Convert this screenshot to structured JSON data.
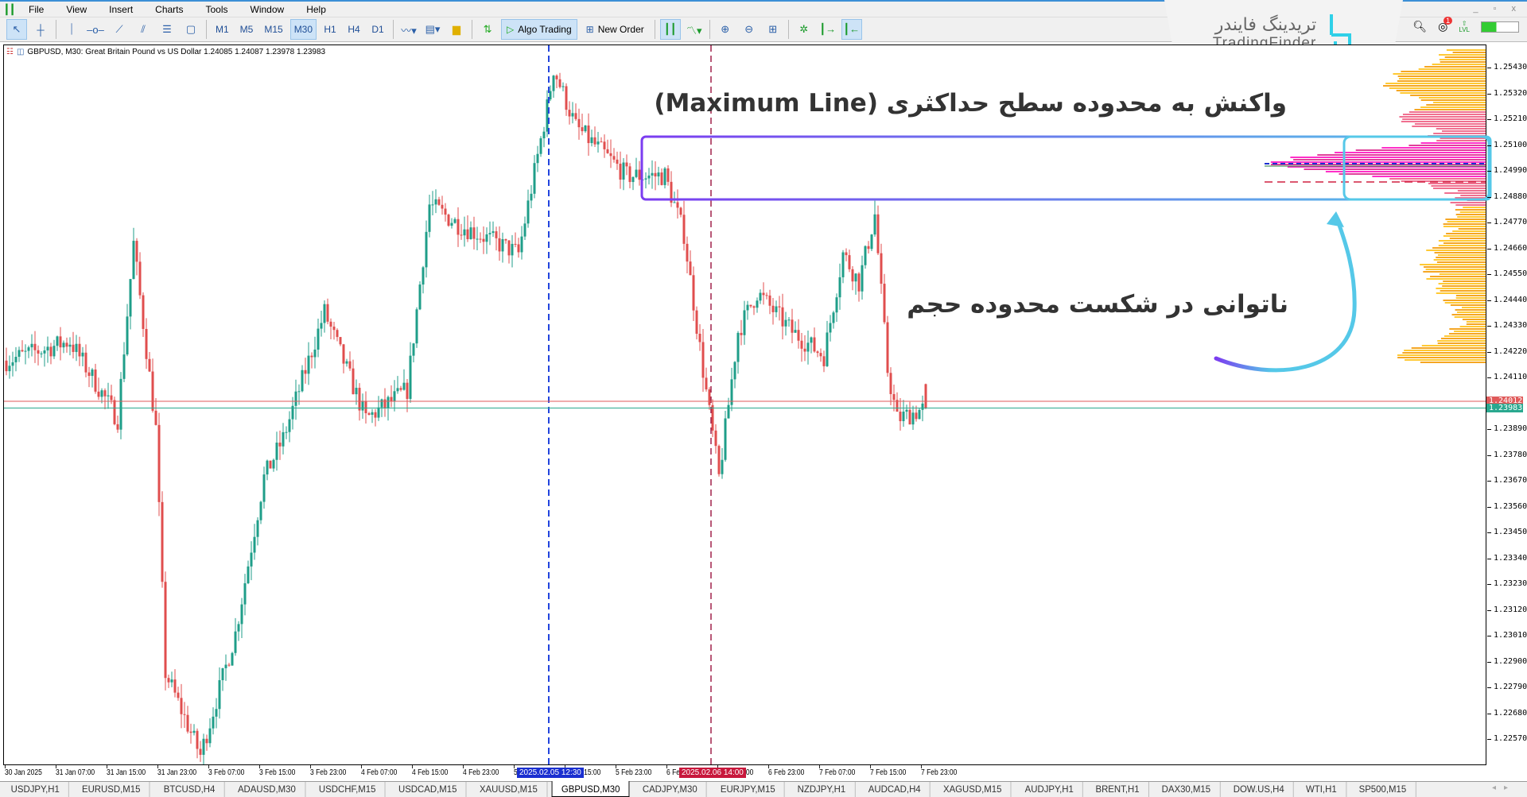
{
  "menu": [
    "File",
    "View",
    "Insert",
    "Charts",
    "Tools",
    "Window",
    "Help"
  ],
  "toolbar": {
    "timeframes": [
      "M1",
      "M5",
      "M15",
      "M30",
      "H1",
      "H4",
      "D1"
    ],
    "active_timeframe": "M30",
    "algo_trading": "Algo Trading",
    "new_order": "New Order"
  },
  "window_controls": "_ ▫ x",
  "notifications_badge": "1",
  "level_label": "LVL",
  "logo": {
    "fa": "تریدینگ فایندر",
    "en": "TradingFinder"
  },
  "chart": {
    "title": "GBPUSD, M30:  Great Britain Pound vs US Dollar  1.24085 1.24087 1.23978 1.23983",
    "price_ticks": [
      "1.25430",
      "1.25320",
      "1.25210",
      "1.25100",
      "1.24990",
      "1.24880",
      "1.24770",
      "1.24660",
      "1.24550",
      "1.24440",
      "1.24330",
      "1.24220",
      "1.24110",
      "1.23890",
      "1.23780",
      "1.23670",
      "1.23560",
      "1.23450",
      "1.23340",
      "1.23230",
      "1.23120",
      "1.23010",
      "1.22900",
      "1.22790",
      "1.22680",
      "1.22570"
    ],
    "bid_price": "1.24012",
    "ask_price": "1.23983",
    "time_ticks": [
      "30 Jan 2025",
      "31 Jan 07:00",
      "31 Jan 15:00",
      "31 Jan 23:00",
      "3 Feb 07:00",
      "3 Feb 15:00",
      "3 Feb 23:00",
      "4 Feb 07:00",
      "4 Feb 15:00",
      "4 Feb 23:00",
      "5 Feb 07:00",
      "5 Feb 15:00",
      "5 Feb 23:00",
      "6 Feb 07:00",
      "6 Feb 15:00",
      "6 Feb 23:00",
      "7 Feb 07:00",
      "7 Feb 15:00",
      "7 Feb 23:00"
    ],
    "vline_blue_label": "2025.02.05 12:30",
    "vline_red_label": "2025.02.06 14:00",
    "colors": {
      "bull": "#1f9e89",
      "bear": "#e04e4e",
      "bid": "#e05a5a",
      "ask": "#2aa88f",
      "vline_blue": "#2244dd",
      "vline_red": "#a0204a"
    }
  },
  "chart_data": {
    "type": "candlestick",
    "symbol": "GBPUSD",
    "timeframe": "M30",
    "price_anchors": [
      [
        0,
        1.24185
      ],
      [
        20,
        1.24268
      ],
      [
        35,
        1.23936
      ],
      [
        40,
        1.24683
      ],
      [
        47,
        1.23894
      ],
      [
        50,
        1.22856
      ],
      [
        61,
        1.22504
      ],
      [
        72,
        1.23022
      ],
      [
        81,
        1.23687
      ],
      [
        87,
        1.23853
      ],
      [
        100,
        1.24392
      ],
      [
        113,
        1.23936
      ],
      [
        126,
        1.2406
      ],
      [
        133,
        1.24849
      ],
      [
        142,
        1.24766
      ],
      [
        161,
        1.24641
      ],
      [
        170,
        1.25264
      ],
      [
        172,
        1.2543
      ],
      [
        179,
        1.25181
      ],
      [
        195,
        1.24973
      ],
      [
        207,
        1.24973
      ],
      [
        213,
        1.24724
      ],
      [
        219,
        1.24143
      ],
      [
        224,
        1.23687
      ],
      [
        230,
        1.24309
      ],
      [
        236,
        1.24475
      ],
      [
        247,
        1.24309
      ],
      [
        257,
        1.24205
      ],
      [
        263,
        1.24641
      ],
      [
        268,
        1.24517
      ],
      [
        273,
        1.24807
      ],
      [
        277,
        1.24143
      ],
      [
        280,
        1.23936
      ],
      [
        289,
        1.23983
      ]
    ],
    "last_ohlc": {
      "open": 1.24085,
      "high": 1.24087,
      "low": 1.23978,
      "close": 1.23983
    },
    "ylim": [
      1.2251,
      1.2549
    ]
  },
  "annotations": {
    "maximum_line": "واکنش به محدوده سطح حداکثری (Maximum Line)",
    "failure": "ناتوانی در شکست محدوده حجم"
  },
  "tabs": [
    "USDJPY,H1",
    "EURUSD,M15",
    "BTCUSD,H4",
    "ADAUSD,M30",
    "USDCHF,M15",
    "USDCAD,M15",
    "XAUUSD,M15",
    "GBPUSD,M30",
    "CADJPY,M30",
    "EURJPY,M15",
    "NZDJPY,H1",
    "AUDCAD,H4",
    "XAGUSD,M15",
    "AUDJPY,H1",
    "BRENT,H1",
    "DAX30,M15",
    "DOW.US,H4",
    "WTI,H1",
    "SP500,M15"
  ],
  "active_tab": "GBPUSD,M30"
}
